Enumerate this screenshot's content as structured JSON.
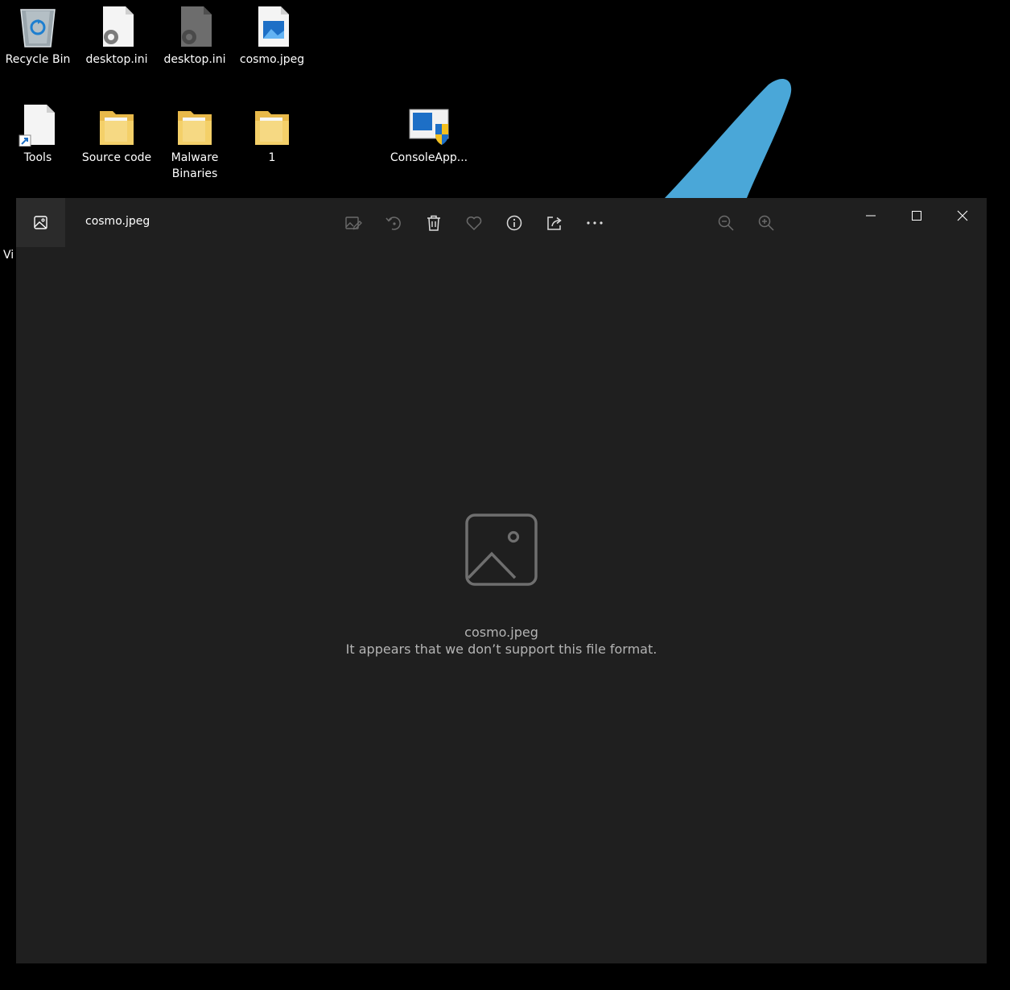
{
  "desktop": {
    "icons": [
      {
        "label": "Recycle Bin",
        "icon": "recycle-bin-icon"
      },
      {
        "label": "desktop.ini",
        "icon": "settings-file-icon"
      },
      {
        "label": "desktop.ini",
        "icon": "settings-file-dark-icon"
      },
      {
        "label": "cosmo.jpeg",
        "icon": "image-file-icon"
      },
      {
        "label": "Tools",
        "icon": "shortcut-file-icon"
      },
      {
        "label": "Source code",
        "icon": "folder-icon"
      },
      {
        "label": "Malware Binaries",
        "icon": "folder-icon"
      },
      {
        "label": "1",
        "icon": "folder-icon"
      },
      {
        "label": "ConsoleApp...",
        "icon": "shield-app-icon"
      }
    ],
    "partial_label": "Vi",
    "brush_color": "#4aa7d8"
  },
  "photos": {
    "title": "cosmo.jpeg",
    "toolbar": [
      {
        "name": "edit",
        "icon": "edit-image-icon",
        "enabled": false
      },
      {
        "name": "rotate",
        "icon": "rotate-icon",
        "enabled": false
      },
      {
        "name": "delete",
        "icon": "trash-icon",
        "enabled": true
      },
      {
        "name": "favorite",
        "icon": "heart-icon",
        "enabled": false
      },
      {
        "name": "info",
        "icon": "info-icon",
        "enabled": true
      },
      {
        "name": "share",
        "icon": "share-icon",
        "enabled": true
      },
      {
        "name": "more",
        "icon": "more-icon",
        "enabled": true
      },
      {
        "name": "zoom-out",
        "icon": "zoom-out-icon",
        "enabled": false
      },
      {
        "name": "zoom-in",
        "icon": "zoom-in-icon",
        "enabled": false
      }
    ],
    "error": {
      "filename": "cosmo.jpeg",
      "message": "It appears that we don’t support this file format."
    },
    "colors": {
      "background": "#1f1f1f",
      "text_muted": "#b4b4b4"
    }
  }
}
